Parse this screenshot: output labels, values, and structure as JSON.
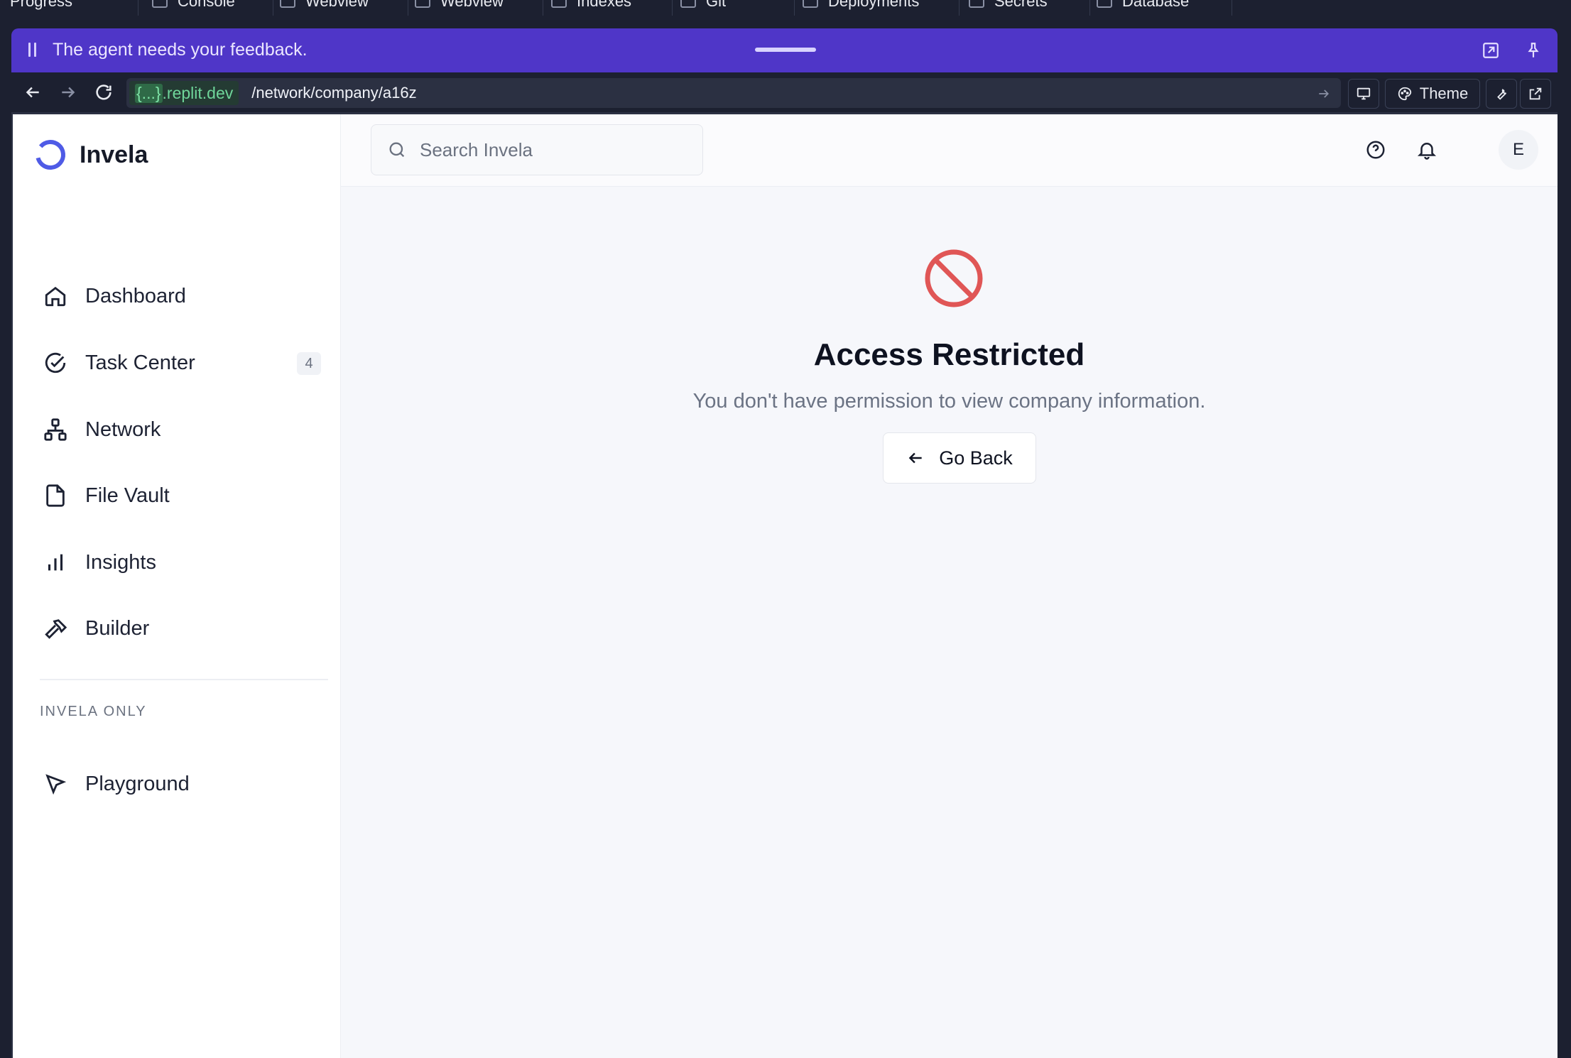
{
  "workspace_tabs": [
    "Progress",
    "Console",
    "Webview",
    "Webview",
    "Indexes",
    "Git",
    "Deployments",
    "Secrets",
    "Database"
  ],
  "agent_bar": {
    "message": "The agent needs your feedback."
  },
  "url_bar": {
    "host": ".replit.dev",
    "host_prefix": "{...}",
    "path": "/network/company/a16z",
    "theme_label": "Theme"
  },
  "app": {
    "brand": "Invela",
    "search_placeholder": "Search Invela",
    "avatar_initial": "E",
    "nav": [
      {
        "label": "Dashboard",
        "icon": "home-icon"
      },
      {
        "label": "Task Center",
        "icon": "check-circle-icon",
        "badge": "4"
      },
      {
        "label": "Network",
        "icon": "network-icon"
      },
      {
        "label": "File Vault",
        "icon": "file-icon"
      },
      {
        "label": "Insights",
        "icon": "bar-chart-icon"
      },
      {
        "label": "Builder",
        "icon": "hammer-icon"
      }
    ],
    "section_label": "INVELA ONLY",
    "section_items": [
      {
        "label": "Playground",
        "icon": "cursor-icon"
      }
    ]
  },
  "main": {
    "title": "Access Restricted",
    "message": "You don't have permission to view company information.",
    "back_label": "Go Back"
  },
  "colors": {
    "accent": "#4f36c8",
    "error": "#e05656",
    "brand": "#4f5be6"
  }
}
